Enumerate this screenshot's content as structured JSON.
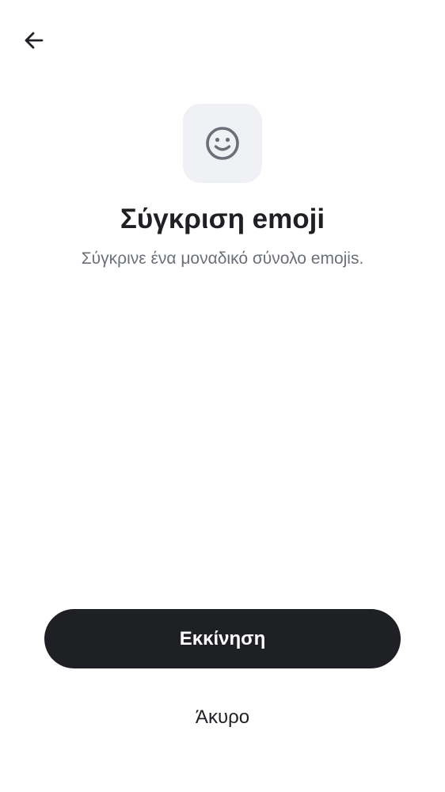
{
  "header": {
    "back_icon": "arrow-left-icon"
  },
  "hero": {
    "icon": "smiley-face-icon",
    "title": "Σύγκριση emoji",
    "subtitle": "Σύγκρινε ένα μοναδικό σύνολο emojis."
  },
  "actions": {
    "start_label": "Εκκίνηση",
    "cancel_label": "Άκυρο"
  },
  "colors": {
    "primary": "#1f2024",
    "tile_background": "#f0f1f5",
    "subtitle_text": "#6b6f78",
    "icon_gray": "#6b6f78"
  }
}
